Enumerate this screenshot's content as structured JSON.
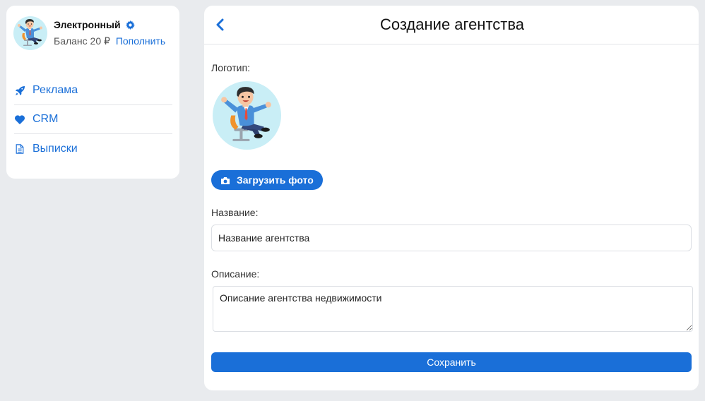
{
  "profile": {
    "name": "Электронный",
    "balance_label": "Баланс 20 ₽",
    "topup_label": "Пополнить"
  },
  "menu": {
    "items": [
      {
        "label": "Реклама",
        "icon": "rocket-icon"
      },
      {
        "label": "CRM",
        "icon": "heart-icon"
      },
      {
        "label": "Выписки",
        "icon": "document-icon"
      }
    ]
  },
  "page": {
    "title": "Создание агентства",
    "logo_label": "Логотип:",
    "upload_label": "Загрузить фото",
    "name_label": "Название:",
    "name_value": "Название агентства",
    "description_label": "Описание:",
    "description_value": "Описание агентства недвижимости",
    "save_label": "Сохранить"
  },
  "colors": {
    "accent": "#1a6fd8",
    "background": "#e9ebee",
    "avatar_bg": "#c9eef6"
  }
}
